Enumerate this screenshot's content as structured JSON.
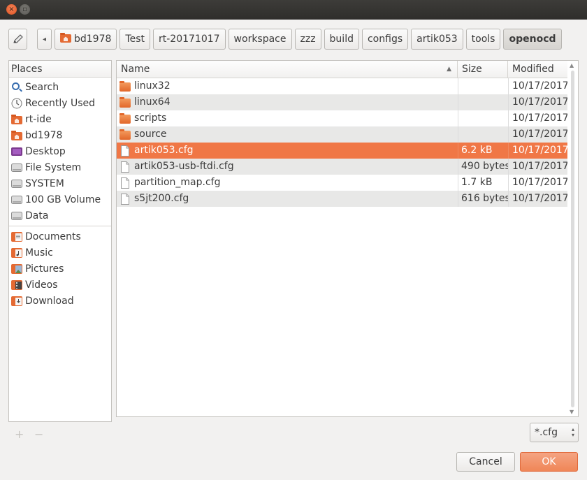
{
  "window": {
    "close_glyph": "×",
    "maximize_glyph": "▫"
  },
  "toolbar": {
    "edit_glyph": "✎",
    "back_glyph": "◂"
  },
  "path": [
    "bd1978",
    "Test",
    "rt-20171017",
    "workspace",
    "zzz",
    "build",
    "configs",
    "artik053",
    "tools",
    "openocd"
  ],
  "places": {
    "header": "Places",
    "groups": [
      [
        {
          "label": "Search",
          "icon": "search-icon"
        },
        {
          "label": "Recently Used",
          "icon": "recent-icon"
        },
        {
          "label": "rt-ide",
          "icon": "home-folder-icon"
        },
        {
          "label": "bd1978",
          "icon": "home-folder-icon"
        },
        {
          "label": "Desktop",
          "icon": "desktop-icon"
        },
        {
          "label": "File System",
          "icon": "drive-icon"
        },
        {
          "label": "SYSTEM",
          "icon": "drive-icon"
        },
        {
          "label": "100 GB Volume",
          "icon": "drive-icon"
        },
        {
          "label": "Data",
          "icon": "drive-icon"
        }
      ],
      [
        {
          "label": "Documents",
          "icon": "documents-folder-icon"
        },
        {
          "label": "Music",
          "icon": "music-folder-icon"
        },
        {
          "label": "Pictures",
          "icon": "pictures-folder-icon"
        },
        {
          "label": "Videos",
          "icon": "videos-folder-icon"
        },
        {
          "label": "Download",
          "icon": "download-folder-icon"
        }
      ]
    ],
    "add_label": "+",
    "remove_label": "−"
  },
  "files": {
    "columns": {
      "name": "Name",
      "size": "Size",
      "modified": "Modified"
    },
    "sort_glyph": "▲",
    "rows": [
      {
        "name": "linux32",
        "type": "folder",
        "size": "",
        "modified": "10/17/2017",
        "selected": false
      },
      {
        "name": "linux64",
        "type": "folder",
        "size": "",
        "modified": "10/17/2017",
        "selected": false
      },
      {
        "name": "scripts",
        "type": "folder",
        "size": "",
        "modified": "10/17/2017",
        "selected": false
      },
      {
        "name": "source",
        "type": "folder",
        "size": "",
        "modified": "10/17/2017",
        "selected": false
      },
      {
        "name": "artik053.cfg",
        "type": "file",
        "size": "6.2 kB",
        "modified": "10/17/2017",
        "selected": true
      },
      {
        "name": "artik053-usb-ftdi.cfg",
        "type": "file",
        "size": "490 bytes",
        "modified": "10/17/2017",
        "selected": false
      },
      {
        "name": "partition_map.cfg",
        "type": "file",
        "size": "1.7 kB",
        "modified": "10/17/2017",
        "selected": false
      },
      {
        "name": "s5jt200.cfg",
        "type": "file",
        "size": "616 bytes",
        "modified": "10/17/2017",
        "selected": false
      }
    ]
  },
  "filter": {
    "value": "*.cfg",
    "spin_up": "▴",
    "spin_down": "▾"
  },
  "buttons": {
    "cancel": "Cancel",
    "ok": "OK"
  },
  "colors": {
    "accent": "#f07746",
    "selection": "#f07746"
  }
}
